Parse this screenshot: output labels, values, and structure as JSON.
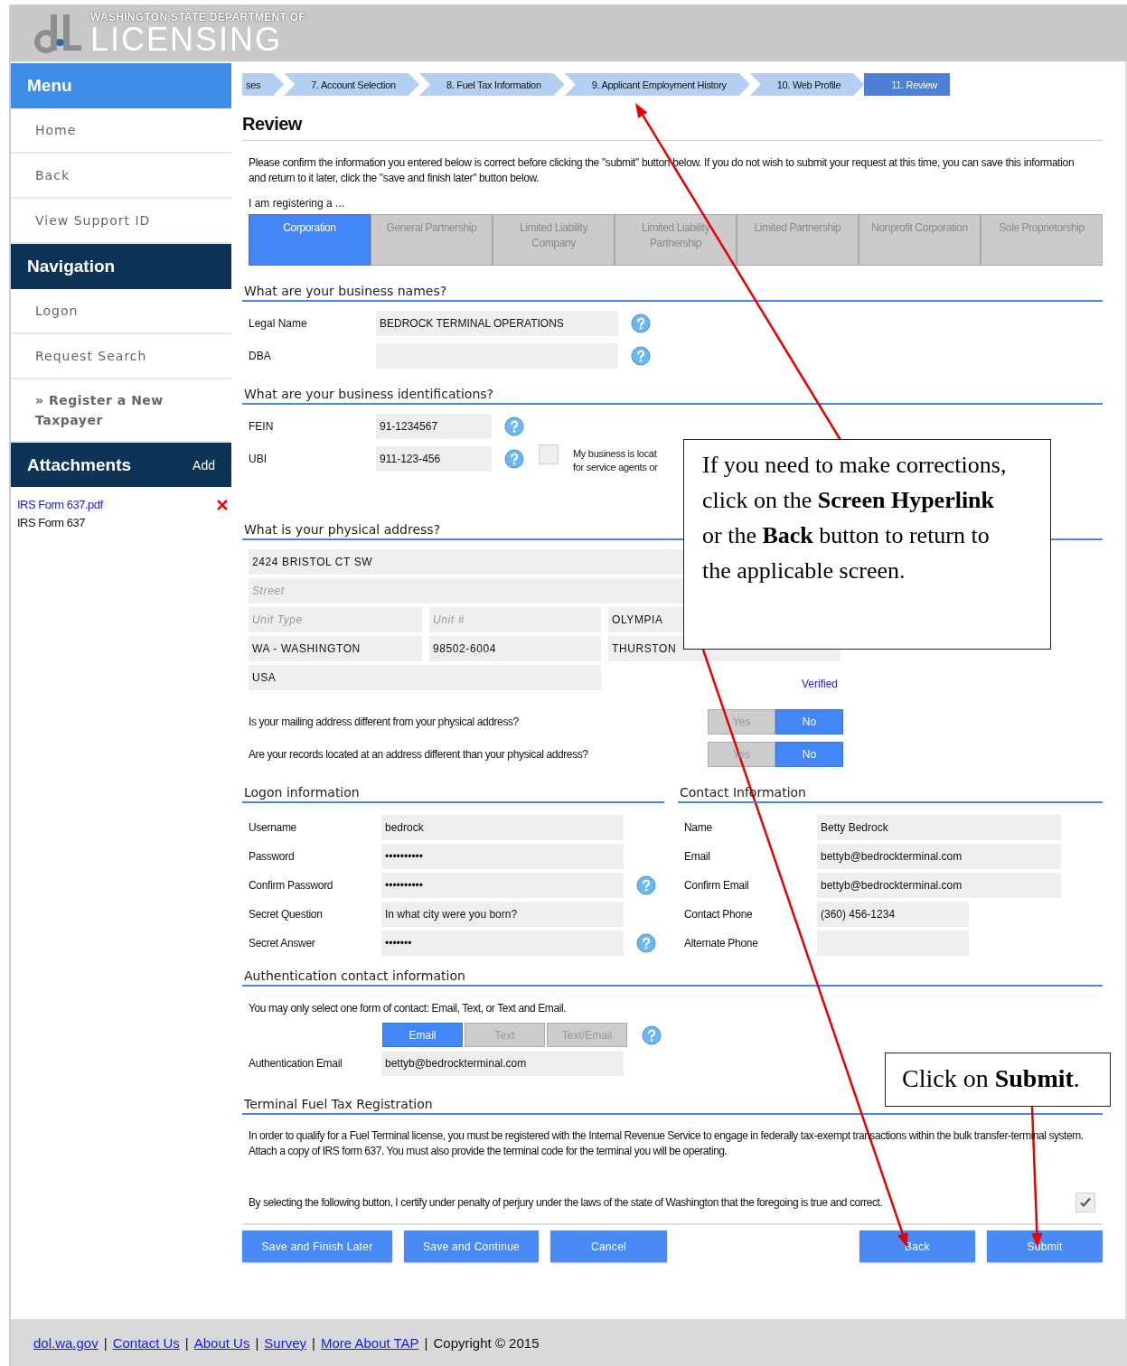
{
  "header": {
    "agency": "WASHINGTON STATE DEPARTMENT OF",
    "name": "LICENSING"
  },
  "sidebar": {
    "menu": {
      "title": "Menu",
      "items": [
        {
          "label": "Home"
        },
        {
          "label": "Back"
        },
        {
          "label": "View Support ID"
        }
      ]
    },
    "navigation": {
      "title": "Navigation",
      "items": [
        {
          "label": "Logon",
          "selected": false
        },
        {
          "label": "Request Search",
          "selected": false
        },
        {
          "label": "» Register a New Taxpayer",
          "selected": true
        }
      ]
    },
    "attachments": {
      "title": "Attachments",
      "action": "Add",
      "files": [
        {
          "link": "IRS Form 637.pdf",
          "description": "IRS Form 637"
        }
      ]
    }
  },
  "steps": [
    {
      "label": "ses",
      "selected": false
    },
    {
      "label": "7. Account Selection",
      "selected": false
    },
    {
      "label": "8. Fuel Tax Information",
      "selected": false
    },
    {
      "label": "9. Applicant Employment History",
      "selected": false
    },
    {
      "label": "10. Web Profile",
      "selected": false
    },
    {
      "label": "11. Review",
      "selected": true
    }
  ],
  "review": {
    "title": "Review",
    "intro": "Please confirm the information you entered below is correct before clicking the \"submit\" button below. If you do not wish to submit your request at this time, you can save this information and return to it later, click the \"save and finish later\" button below.",
    "registering_label": "I am registering a ...",
    "entity_types": [
      {
        "label": "Corporation",
        "selected": true
      },
      {
        "label": "General Partnership",
        "selected": false
      },
      {
        "label": "Limited Liability Company",
        "selected": false
      },
      {
        "label": "Limited Liability Partnership",
        "selected": false
      },
      {
        "label": "Limited Partnership",
        "selected": false
      },
      {
        "label": "Nonprofit Corporation",
        "selected": false
      },
      {
        "label": "Sole Proprietorship",
        "selected": false
      }
    ]
  },
  "business_names": {
    "title": "What are your business names?",
    "fields": [
      {
        "label": "Legal Name",
        "value": "BEDROCK TERMINAL OPERATIONS",
        "help": true
      },
      {
        "label": "DBA",
        "help": true
      }
    ]
  },
  "identifications": {
    "title": "What are your business identifications?",
    "fields": [
      {
        "label": "FEIN",
        "value": "91-1234567",
        "help": true
      },
      {
        "label": "UBI",
        "value": "911-123-456",
        "help": true,
        "checkbox": {
          "checked": false,
          "label_lines": [
            "My business is locat",
            "for service agents or"
          ]
        }
      }
    ]
  },
  "physical_address": {
    "title": "What is your physical address?",
    "rows": [
      {
        "kind": "full",
        "cells": [
          {
            "value": "2424 BRISTOL CT SW"
          }
        ]
      },
      {
        "kind": "full",
        "cells": [
          {
            "placeholder": "Street"
          }
        ]
      },
      {
        "kind": "thirds",
        "cells": [
          {
            "placeholder": "Unit Type"
          },
          {
            "placeholder": "Unit #"
          },
          {
            "value": "OLYMPIA"
          }
        ]
      },
      {
        "kind": "thirds",
        "cells": [
          {
            "value": "WA - WASHINGTON"
          },
          {
            "value": "98502-6004"
          },
          {
            "value": "THURSTON"
          }
        ]
      },
      {
        "kind": "country",
        "cells": [
          {
            "value": "USA"
          }
        ],
        "status": "Verified"
      }
    ]
  },
  "questions": [
    {
      "text": "Is your mailing address different from your physical address?",
      "options": [
        {
          "label": "Yes",
          "selected": false
        },
        {
          "label": "No",
          "selected": true
        }
      ]
    },
    {
      "text": "Are your records located at an address different than your physical address?",
      "options": [
        {
          "label": "Yes",
          "selected": false
        },
        {
          "label": "No",
          "selected": true
        }
      ]
    }
  ],
  "logon": {
    "title": "Logon information",
    "fields": [
      {
        "label": "Username",
        "value": "bedrock",
        "help": false
      },
      {
        "label": "Password",
        "value": "••••••••••",
        "help": false
      },
      {
        "label": "Confirm Password",
        "value": "••••••••••",
        "help": true
      },
      {
        "label": "Secret Question",
        "value": "In what city were you born?",
        "help": false
      },
      {
        "label": "Secret Answer",
        "value": "•••••••",
        "help": true
      }
    ]
  },
  "contact": {
    "title": "Contact Information",
    "fields": [
      {
        "label": "Name",
        "value": "Betty Bedrock",
        "kind": "text"
      },
      {
        "label": "Email",
        "value": "bettyb@bedrockterminal.com",
        "kind": "text"
      },
      {
        "label": "Confirm Email",
        "value": "bettyb@bedrockterminal.com",
        "kind": "text"
      },
      {
        "label": "Contact Phone",
        "value": "(360) 456-1234",
        "kind": "phone"
      },
      {
        "label": "Alternate Phone",
        "kind": "phone"
      }
    ]
  },
  "authentication": {
    "title": "Authentication contact information",
    "note": "You may only select one form of contact: Email, Text, or Text and Email.",
    "options": [
      {
        "label": "Email",
        "selected": true
      },
      {
        "label": "Text",
        "selected": false
      },
      {
        "label": "Text/Email",
        "selected": false
      }
    ],
    "help": true,
    "field": {
      "label": "Authentication Email",
      "value": "bettyb@bedrockterminal.com"
    }
  },
  "terminal": {
    "title": "Terminal Fuel Tax Registration",
    "paragraph": "In order to qualify for a Fuel Terminal license, you must be registered with the Internal Revenue Service to engage in federally tax-exempt transactions within the bulk transfer-terminal system. Attach a copy of IRS form 637. You must also provide the terminal code for the terminal you will be operating.",
    "certify": {
      "text": "By selecting the following button, I certify under penalty of perjury under the laws of the state of Washington that the foregoing is true and correct.",
      "checked": true
    }
  },
  "buttons": {
    "left": [
      "Save and Finish Later",
      "Save and Continue",
      "Cancel"
    ],
    "right": [
      "Back",
      "Submit"
    ]
  },
  "footer": {
    "items": [
      {
        "kind": "link",
        "text": "dol.wa.gov"
      },
      {
        "kind": "separator",
        "text": "|"
      },
      {
        "kind": "link",
        "text": "Contact Us"
      },
      {
        "kind": "separator",
        "text": "|"
      },
      {
        "kind": "link",
        "text": "About Us"
      },
      {
        "kind": "separator",
        "text": "|"
      },
      {
        "kind": "link",
        "text": "Survey"
      },
      {
        "kind": "separator",
        "text": "|"
      },
      {
        "kind": "link",
        "text": "More About TAP"
      },
      {
        "kind": "separator",
        "text": "|"
      },
      {
        "kind": "text",
        "text": "Copyright © 2015"
      }
    ]
  },
  "callouts": [
    {
      "text": "If you need to make corrections, click on the **Screen Hyperlink** or the **Back** button to return to the applicable screen."
    },
    {
      "text": "Click on **Submit**."
    }
  ]
}
